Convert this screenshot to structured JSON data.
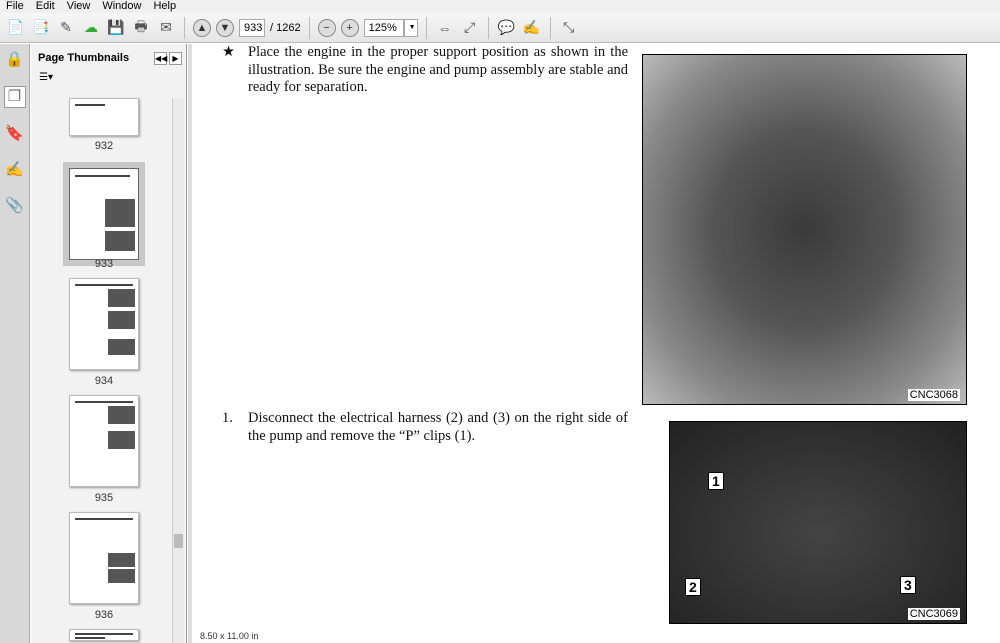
{
  "menu": [
    "File",
    "Edit",
    "View",
    "Window",
    "Help"
  ],
  "toolbar": {
    "page_current": "933",
    "page_total": "/ 1262",
    "zoom": "125%"
  },
  "panel": {
    "title": "Page Thumbnails",
    "thumbnails": [
      {
        "label": "932"
      },
      {
        "label": "933",
        "selected": true
      },
      {
        "label": "934"
      },
      {
        "label": "935"
      },
      {
        "label": "936"
      }
    ]
  },
  "document": {
    "step_star_bullet": "★",
    "step_star_text": "Place the engine in the proper support position as shown in the illustration. Be sure the engine and pump assembly are stable and ready for separation.",
    "photo1_caption": "CNC3068",
    "step1_number": "1.",
    "step1_text": "Disconnect the electrical harness (2) and (3) on the right side of the pump and remove the “P” clips (1).",
    "photo2_caption": "CNC3069",
    "callouts": [
      "1",
      "2",
      "3"
    ]
  },
  "status": {
    "page_size": "8.50 x 11.00 in"
  }
}
